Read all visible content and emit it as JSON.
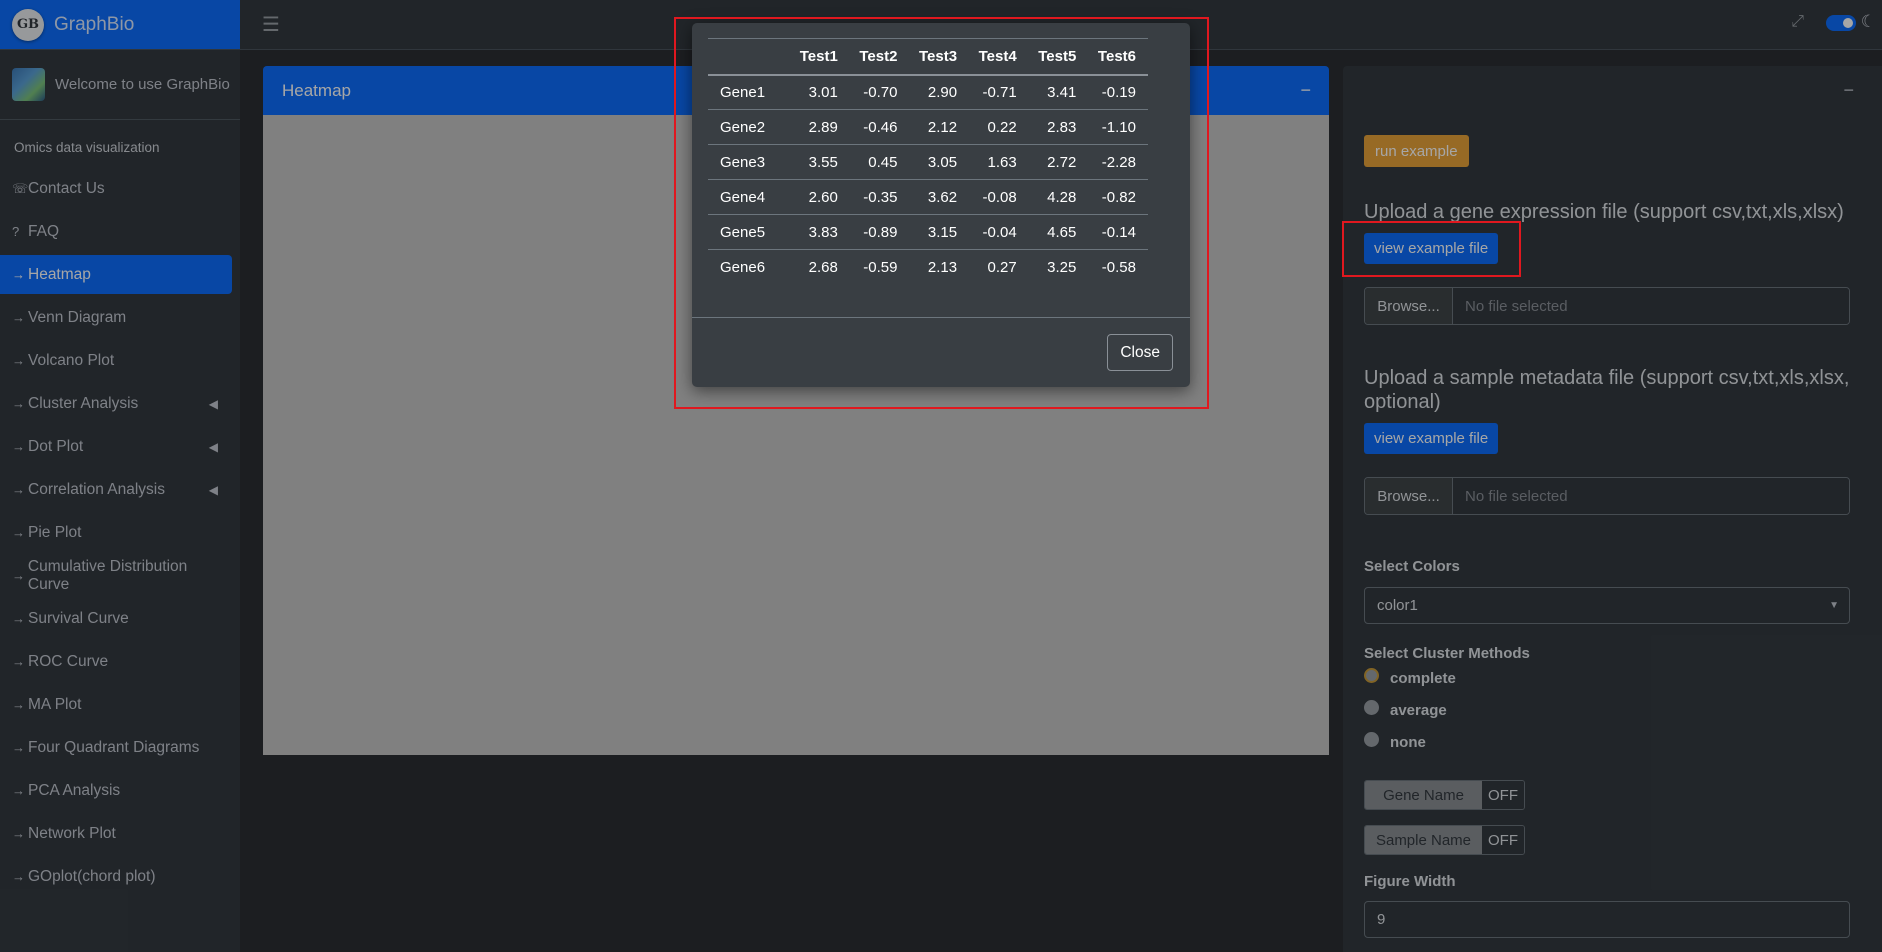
{
  "brand": {
    "logo_text": "GB",
    "title": "GraphBio"
  },
  "user": {
    "welcome": "Welcome to use GraphBio"
  },
  "sidebar": {
    "header": "Omics data visualization",
    "items": [
      {
        "label": "Contact Us",
        "icon": "☏"
      },
      {
        "label": "FAQ",
        "icon": "?"
      },
      {
        "label": "Heatmap",
        "icon": "→"
      },
      {
        "label": "Venn Diagram",
        "icon": "→"
      },
      {
        "label": "Volcano Plot",
        "icon": "→"
      },
      {
        "label": "Cluster Analysis",
        "icon": "→"
      },
      {
        "label": "Dot Plot",
        "icon": "→"
      },
      {
        "label": "Correlation Analysis",
        "icon": "→"
      },
      {
        "label": "Pie Plot",
        "icon": "→"
      },
      {
        "label": "Cumulative Distribution Curve",
        "icon": "→"
      },
      {
        "label": "Survival Curve",
        "icon": "→"
      },
      {
        "label": "ROC Curve",
        "icon": "→"
      },
      {
        "label": "MA Plot",
        "icon": "→"
      },
      {
        "label": "Four Quadrant Diagrams",
        "icon": "→"
      },
      {
        "label": "PCA Analysis",
        "icon": "→"
      },
      {
        "label": "Network Plot",
        "icon": "→"
      },
      {
        "label": "GOplot(chord plot)",
        "icon": "→"
      }
    ],
    "active": "Heatmap"
  },
  "main": {
    "card_title": "Heatmap"
  },
  "right_panel": {
    "run_example": "run example",
    "upload_expression_label": "Upload a gene expression file (support csv,txt,xls,xlsx)",
    "view_example_1": "view example file",
    "browse_1": "Browse...",
    "file_status_1": "No file selected",
    "upload_metadata_label": "Upload a sample metadata file (support csv,txt,xls,xlsx, optional)",
    "view_example_2": "view example file",
    "browse_2": "Browse...",
    "file_status_2": "No file selected",
    "select_colors_label": "Select Colors",
    "select_colors_value": "color1",
    "cluster_methods_label": "Select Cluster Methods",
    "cluster_methods": [
      "complete",
      "average",
      "none"
    ],
    "cluster_selected": "complete",
    "gene_name_label": "Gene Name",
    "gene_name_state": "OFF",
    "sample_name_label": "Sample Name",
    "sample_name_state": "OFF",
    "figure_width_label": "Figure Width",
    "figure_width_value": "9"
  },
  "modal": {
    "columns": [
      "",
      "Test1",
      "Test2",
      "Test3",
      "Test4",
      "Test5",
      "Test6"
    ],
    "rows": [
      [
        "Gene1",
        "3.01",
        "-0.70",
        "2.90",
        "-0.71",
        "3.41",
        "-0.19"
      ],
      [
        "Gene2",
        "2.89",
        "-0.46",
        "2.12",
        "0.22",
        "2.83",
        "-1.10"
      ],
      [
        "Gene3",
        "3.55",
        "0.45",
        "3.05",
        "1.63",
        "2.72",
        "-2.28"
      ],
      [
        "Gene4",
        "2.60",
        "-0.35",
        "3.62",
        "-0.08",
        "4.28",
        "-0.82"
      ],
      [
        "Gene5",
        "3.83",
        "-0.89",
        "3.15",
        "-0.04",
        "4.65",
        "-0.14"
      ],
      [
        "Gene6",
        "2.68",
        "-0.59",
        "2.13",
        "0.27",
        "3.25",
        "-0.58"
      ]
    ],
    "close_label": "Close"
  },
  "colors": {
    "accent": "#0d6efd",
    "run_button": "#e8a43a",
    "annotation": "#e0181f"
  }
}
